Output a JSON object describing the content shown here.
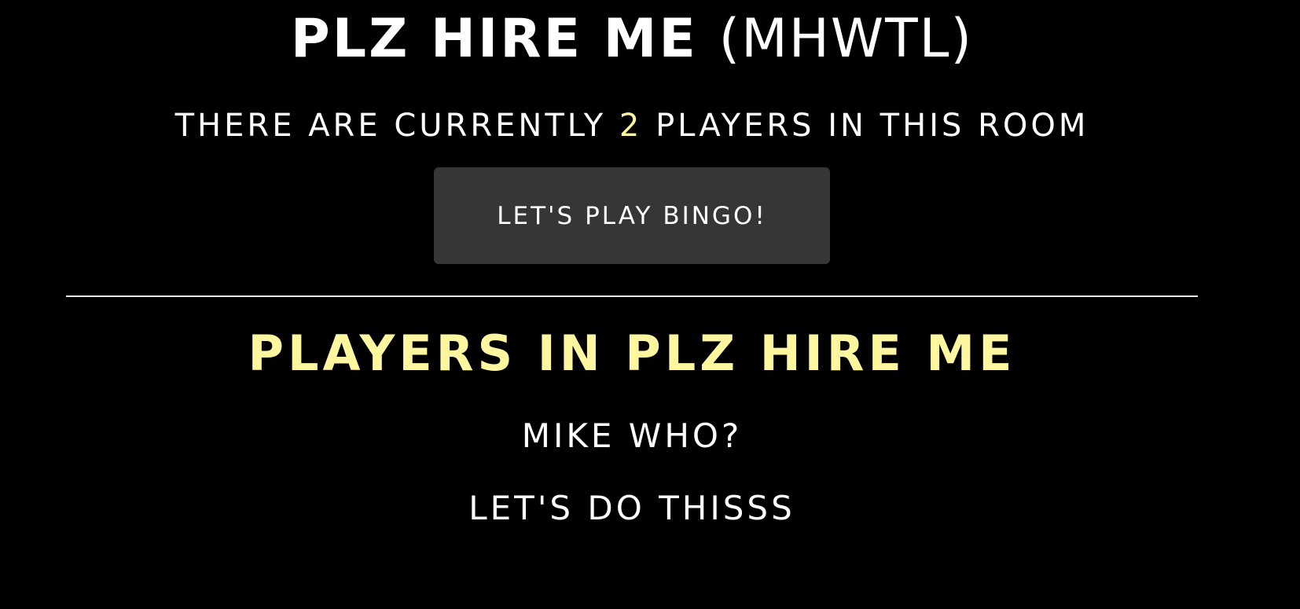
{
  "room": {
    "name": "PLZ HIRE ME",
    "code": "(MHWTL)"
  },
  "status": {
    "prefix": "THERE ARE CURRENTLY",
    "count": "2",
    "suffix": "PLAYERS IN THIS ROOM"
  },
  "actions": {
    "play_label": "LET'S PLAY BINGO!"
  },
  "players_section": {
    "heading_prefix": "PLAYERS IN",
    "room_name": "PLZ HIRE ME"
  },
  "players": [
    {
      "name": "MIKE WHO?"
    },
    {
      "name": "LET'S DO THISSS"
    }
  ],
  "colors": {
    "background": "#000000",
    "text": "#ffffff",
    "accent": "#fff7a0",
    "button": "#363636"
  }
}
